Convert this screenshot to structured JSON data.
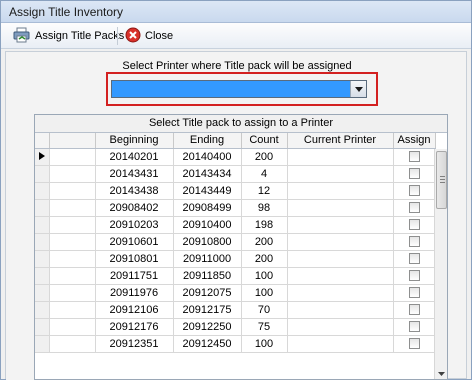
{
  "window": {
    "title": "Assign Title Inventory"
  },
  "toolbar": {
    "assign_label": "Assign Title Packs",
    "close_label": "Close"
  },
  "printer": {
    "label": "Select Printer where Title pack will be assigned",
    "selected": ""
  },
  "grid": {
    "caption": "Select Title pack to assign to a Printer",
    "columns": [
      "",
      "Beginning",
      "Ending",
      "Count",
      "Current Printer",
      "Assign"
    ],
    "rows": [
      {
        "beginning": "20140201",
        "ending": "20140400",
        "count": "200",
        "current_printer": "",
        "assign": false
      },
      {
        "beginning": "20143431",
        "ending": "20143434",
        "count": "4",
        "current_printer": "",
        "assign": false
      },
      {
        "beginning": "20143438",
        "ending": "20143449",
        "count": "12",
        "current_printer": "",
        "assign": false
      },
      {
        "beginning": "20908402",
        "ending": "20908499",
        "count": "98",
        "current_printer": "",
        "assign": false
      },
      {
        "beginning": "20910203",
        "ending": "20910400",
        "count": "198",
        "current_printer": "",
        "assign": false
      },
      {
        "beginning": "20910601",
        "ending": "20910800",
        "count": "200",
        "current_printer": "",
        "assign": false
      },
      {
        "beginning": "20910801",
        "ending": "20911000",
        "count": "200",
        "current_printer": "",
        "assign": false
      },
      {
        "beginning": "20911751",
        "ending": "20911850",
        "count": "100",
        "current_printer": "",
        "assign": false
      },
      {
        "beginning": "20911976",
        "ending": "20912075",
        "count": "100",
        "current_printer": "",
        "assign": false
      },
      {
        "beginning": "20912106",
        "ending": "20912175",
        "count": "70",
        "current_printer": "",
        "assign": false
      },
      {
        "beginning": "20912176",
        "ending": "20912250",
        "count": "75",
        "current_printer": "",
        "assign": false
      },
      {
        "beginning": "20912351",
        "ending": "20912450",
        "count": "100",
        "current_printer": "",
        "assign": false
      }
    ]
  },
  "colors": {
    "combo_fill": "#3399ff",
    "highlight": "#d32020"
  },
  "icons": {
    "assign": "printer-assign-icon",
    "close": "close-circle-icon",
    "dropdown": "chevron-down-icon",
    "current_row": "row-pointer-icon"
  }
}
